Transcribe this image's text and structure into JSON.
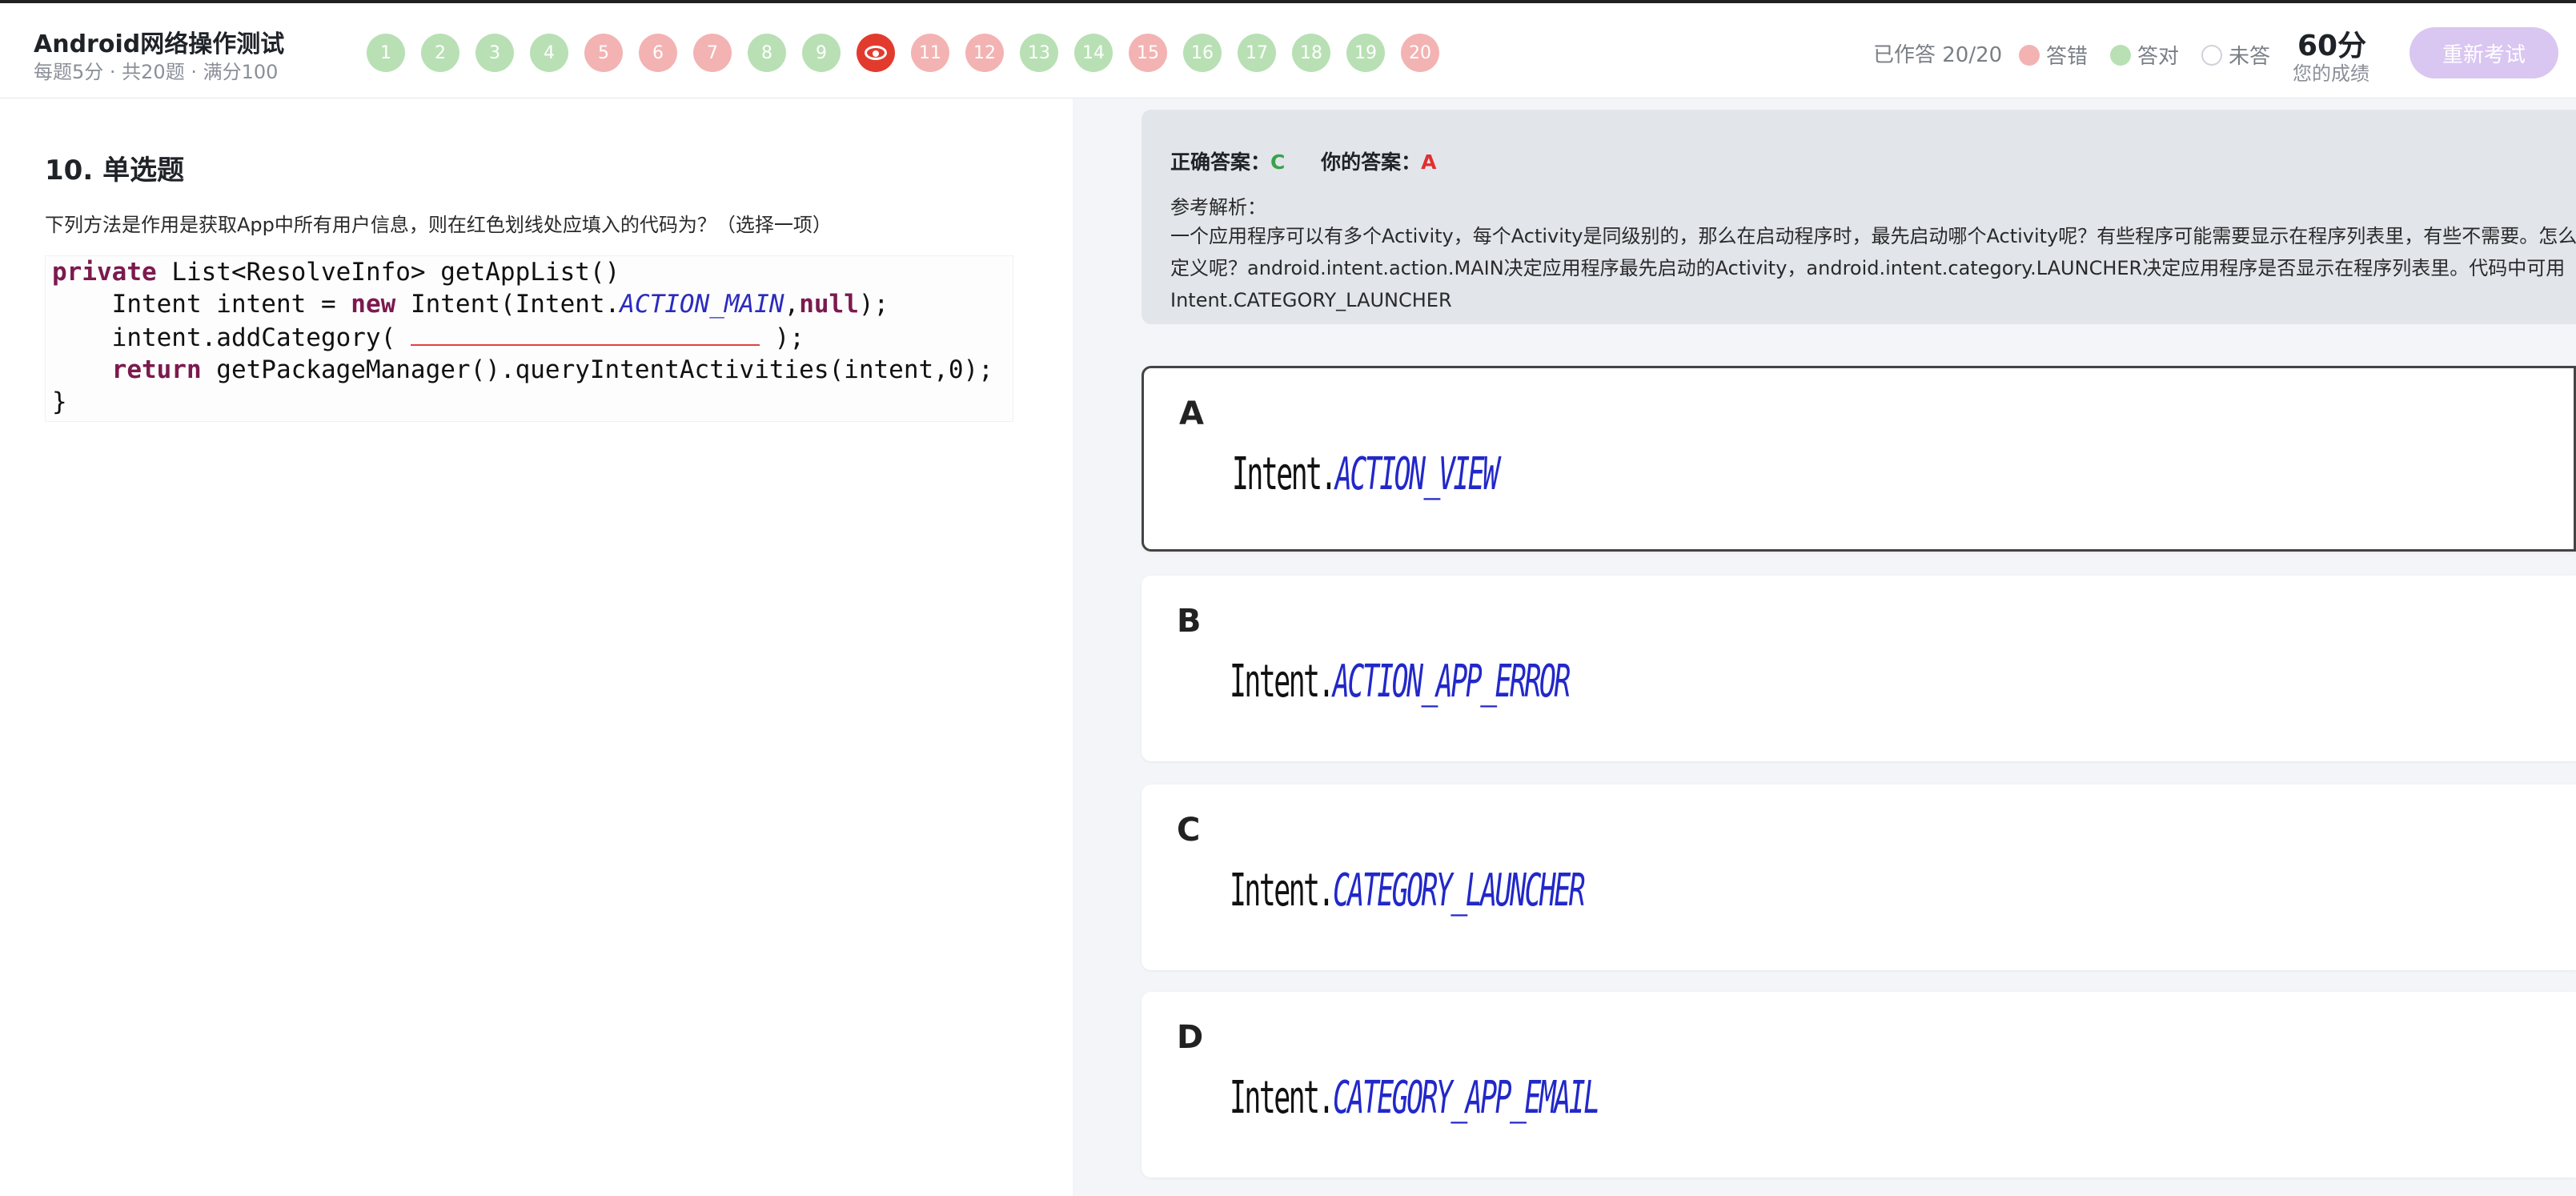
{
  "header": {
    "title": "Android网络操作测试",
    "subtitle": "每题5分 · 共20题 · 满分100",
    "questions": [
      {
        "label": "1",
        "state": "correct"
      },
      {
        "label": "2",
        "state": "correct"
      },
      {
        "label": "3",
        "state": "correct"
      },
      {
        "label": "4",
        "state": "correct"
      },
      {
        "label": "5",
        "state": "wrong"
      },
      {
        "label": "6",
        "state": "wrong"
      },
      {
        "label": "7",
        "state": "wrong"
      },
      {
        "label": "8",
        "state": "correct"
      },
      {
        "label": "9",
        "state": "correct"
      },
      {
        "label": "10",
        "state": "current"
      },
      {
        "label": "11",
        "state": "wrong"
      },
      {
        "label": "12",
        "state": "wrong"
      },
      {
        "label": "13",
        "state": "correct"
      },
      {
        "label": "14",
        "state": "correct"
      },
      {
        "label": "15",
        "state": "wrong"
      },
      {
        "label": "16",
        "state": "correct"
      },
      {
        "label": "17",
        "state": "correct"
      },
      {
        "label": "18",
        "state": "correct"
      },
      {
        "label": "19",
        "state": "correct"
      },
      {
        "label": "20",
        "state": "wrong"
      }
    ],
    "status": "已作答 20/20",
    "legend": {
      "wrong": "答错",
      "correct": "答对",
      "unanswered": "未答"
    },
    "score": "60分",
    "score_label": "您的成绩",
    "retake_label": "重新考试"
  },
  "question": {
    "title": "10. 单选题",
    "text": "下列方法是作用是获取App中所有用户信息，则在红色划线处应填入的代码为？（选择一项）",
    "code": {
      "l1_kw": "private",
      "l1_rest": " List<ResolveInfo> getAppList()",
      "l2_a": "    Intent intent = ",
      "l2_kw": "new",
      "l2_b": " Intent(Intent.",
      "l2_const": "ACTION_MAIN",
      "l2_c": ",",
      "l2_null": "null",
      "l2_d": ");",
      "l3_a": "    intent.addCategory( ",
      "l3_b": " );",
      "l4_a": "    ",
      "l4_kw": "return",
      "l4_b": " getPackageManager().queryIntentActivities(intent,0);",
      "l5": "}"
    }
  },
  "answer": {
    "correct_label": "正确答案：",
    "correct_value": "C",
    "yours_label": "你的答案：",
    "yours_value": "A",
    "ref_label": "参考解析：",
    "ref_text": "一个应用程序可以有多个Activity，每个Activity是同级别的，那么在启动程序时，最先启动哪个Activity呢？有些程序可能需要显示在程序列表里，有些不需要。怎么定义呢？android.intent.action.MAIN决定应用程序最先启动的Activity，android.intent.category.LAUNCHER决定应用程序是否显示在程序列表里。代码中可用Intent.CATEGORY_LAUNCHER"
  },
  "options": [
    {
      "letter": "A",
      "prefix": "Intent.",
      "const": "ACTION_VIEW"
    },
    {
      "letter": "B",
      "prefix": "Intent.",
      "const": "ACTION_APP_ERROR"
    },
    {
      "letter": "C",
      "prefix": "Intent.",
      "const": "CATEGORY_LAUNCHER"
    },
    {
      "letter": "D",
      "prefix": "Intent.",
      "const": "CATEGORY_APP_EMAIL"
    }
  ],
  "colors": {
    "correct": "#b8e0b4",
    "wrong": "#f3b3b3",
    "current": "#e23b2e",
    "accent": "#d9c6f1"
  }
}
